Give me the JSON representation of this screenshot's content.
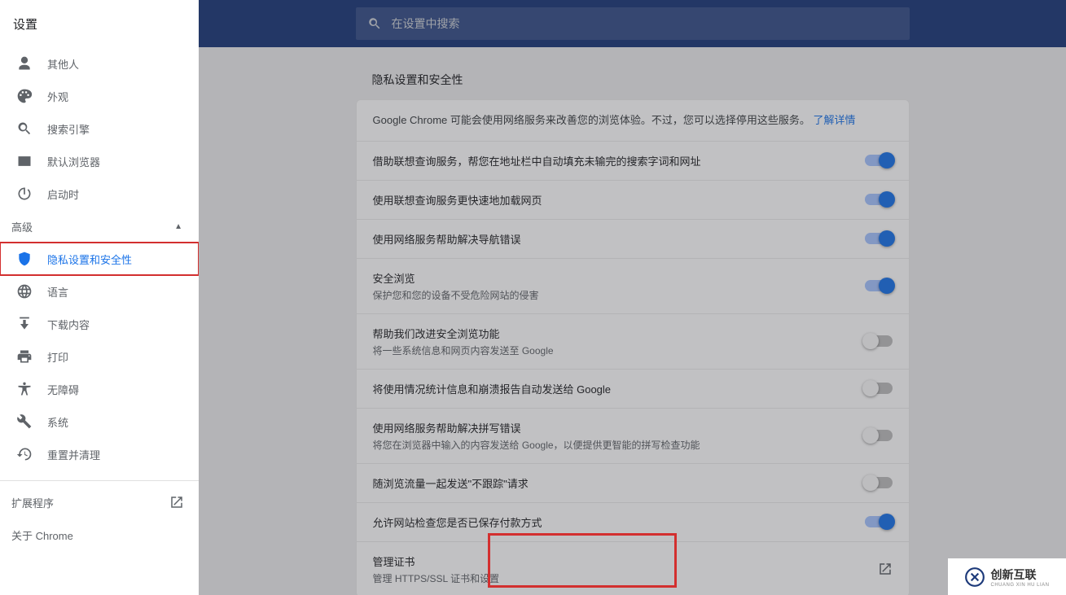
{
  "sidebar": {
    "title": "设置",
    "nav": [
      {
        "label": "其他人",
        "icon": "person"
      },
      {
        "label": "外观",
        "icon": "palette"
      },
      {
        "label": "搜索引擎",
        "icon": "search"
      },
      {
        "label": "默认浏览器",
        "icon": "browser"
      },
      {
        "label": "启动时",
        "icon": "power"
      }
    ],
    "advanced_label": "高级",
    "adv_nav": [
      {
        "label": "隐私设置和安全性",
        "icon": "shield",
        "active": true
      },
      {
        "label": "语言",
        "icon": "globe"
      },
      {
        "label": "下载内容",
        "icon": "download"
      },
      {
        "label": "打印",
        "icon": "print"
      },
      {
        "label": "无障碍",
        "icon": "accessibility"
      },
      {
        "label": "系统",
        "icon": "wrench"
      },
      {
        "label": "重置并清理",
        "icon": "restore"
      }
    ],
    "extensions_label": "扩展程序",
    "about_label": "关于 Chrome"
  },
  "search": {
    "placeholder": "在设置中搜索"
  },
  "section": {
    "title": "隐私设置和安全性",
    "info_prefix": "Google Chrome 可能会使用网络服务来改善您的浏览体验。不过，您可以选择停用这些服务。",
    "info_link": "了解详情",
    "rows": [
      {
        "title": "借助联想查询服务，帮您在地址栏中自动填充未输完的搜索字词和网址",
        "desc": "",
        "ctrl": "toggle",
        "on": true
      },
      {
        "title": "使用联想查询服务更快速地加载网页",
        "desc": "",
        "ctrl": "toggle",
        "on": true
      },
      {
        "title": "使用网络服务帮助解决导航错误",
        "desc": "",
        "ctrl": "toggle",
        "on": true
      },
      {
        "title": "安全浏览",
        "desc": "保护您和您的设备不受危险网站的侵害",
        "ctrl": "toggle",
        "on": true
      },
      {
        "title": "帮助我们改进安全浏览功能",
        "desc": "将一些系统信息和网页内容发送至 Google",
        "ctrl": "toggle",
        "on": false
      },
      {
        "title": "将使用情况统计信息和崩溃报告自动发送给 Google",
        "desc": "",
        "ctrl": "toggle",
        "on": false
      },
      {
        "title": "使用网络服务帮助解决拼写错误",
        "desc": "将您在浏览器中输入的内容发送给 Google，以便提供更智能的拼写检查功能",
        "ctrl": "toggle",
        "on": false
      },
      {
        "title": "随浏览流量一起发送\"不跟踪\"请求",
        "desc": "",
        "ctrl": "toggle",
        "on": false
      },
      {
        "title": "允许网站检查您是否已保存付款方式",
        "desc": "",
        "ctrl": "toggle",
        "on": true
      },
      {
        "title": "管理证书",
        "desc": "管理 HTTPS/SSL 证书和设置",
        "ctrl": "ext"
      }
    ]
  },
  "watermark": {
    "brand": "创新互联",
    "sub": "CHUANG XIN HU LIAN"
  }
}
